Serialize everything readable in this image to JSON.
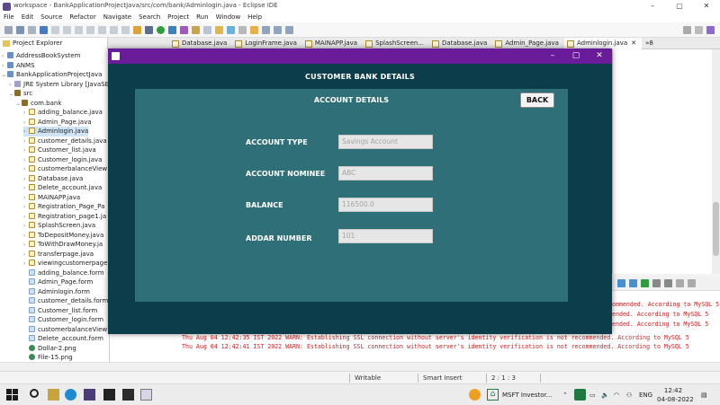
{
  "eclipse": {
    "title": "workspace - BankApplicationProjectJava/src/com/bank/Adminlogin.java - Eclipse IDE",
    "menu": [
      "File",
      "Edit",
      "Source",
      "Refactor",
      "Navigate",
      "Search",
      "Project",
      "Run",
      "Window",
      "Help"
    ],
    "explorer_tab": "Project Explorer",
    "editor_tabs": [
      "Database.java",
      "LoginFrame.java",
      "MAINAPP.java",
      "SplashScreen...",
      "Database.java",
      "Admin_Page.java",
      "Adminlogin.java"
    ],
    "overflow_count": "8",
    "tree": [
      {
        "label": "AddressBookSystem",
        "type": "proj",
        "indent": 0,
        "arrow": ">"
      },
      {
        "label": "ANMS",
        "type": "proj",
        "indent": 0,
        "arrow": ">"
      },
      {
        "label": "BankApplicationProjectJava",
        "type": "proj",
        "indent": 0,
        "arrow": "v"
      },
      {
        "label": "JRE System Library [JavaSE-",
        "type": "lib",
        "indent": 1,
        "arrow": ">"
      },
      {
        "label": "src",
        "type": "pkg",
        "indent": 1,
        "arrow": "v"
      },
      {
        "label": "com.bank",
        "type": "pkg",
        "indent": 2,
        "arrow": "v"
      },
      {
        "label": "adding_balance.java",
        "type": "java",
        "indent": 3,
        "arrow": ">"
      },
      {
        "label": "Admin_Page.java",
        "type": "java",
        "indent": 3,
        "arrow": ">"
      },
      {
        "label": "Adminlogin.java",
        "type": "java",
        "indent": 3,
        "arrow": ">",
        "selected": true
      },
      {
        "label": "customer_details.java",
        "type": "java",
        "indent": 3,
        "arrow": ">"
      },
      {
        "label": "Customer_list.java",
        "type": "java",
        "indent": 3,
        "arrow": ">"
      },
      {
        "label": "Customer_login.java",
        "type": "java",
        "indent": 3,
        "arrow": ">"
      },
      {
        "label": "customerbalanceView",
        "type": "java",
        "indent": 3,
        "arrow": ">"
      },
      {
        "label": "Database.java",
        "type": "java",
        "indent": 3,
        "arrow": ">"
      },
      {
        "label": "Delete_account.java",
        "type": "java",
        "indent": 3,
        "arrow": ">"
      },
      {
        "label": "MAINAPP.java",
        "type": "java",
        "indent": 3,
        "arrow": ">"
      },
      {
        "label": "Registration_Page_Pa",
        "type": "java",
        "indent": 3,
        "arrow": ">"
      },
      {
        "label": "Registration_page1.ja",
        "type": "java",
        "indent": 3,
        "arrow": ">"
      },
      {
        "label": "SplashScreen.java",
        "type": "java",
        "indent": 3,
        "arrow": ">"
      },
      {
        "label": "ToDepositMoney.java",
        "type": "java",
        "indent": 3,
        "arrow": ">"
      },
      {
        "label": "ToWithDrawMoney.ja",
        "type": "java",
        "indent": 3,
        "arrow": ">"
      },
      {
        "label": "transferpage.java",
        "type": "java",
        "indent": 3,
        "arrow": ">"
      },
      {
        "label": "viewingcustomerpage",
        "type": "java",
        "indent": 3,
        "arrow": ">"
      },
      {
        "label": "adding_balance.form",
        "type": "form",
        "indent": 3,
        "arrow": ""
      },
      {
        "label": "Admin_Page.form",
        "type": "form",
        "indent": 3,
        "arrow": ""
      },
      {
        "label": "Adminlogin.form",
        "type": "form",
        "indent": 3,
        "arrow": ""
      },
      {
        "label": "customer_details.form",
        "type": "form",
        "indent": 3,
        "arrow": ""
      },
      {
        "label": "Customer_list.form",
        "type": "form",
        "indent": 3,
        "arrow": ""
      },
      {
        "label": "Customer_login.form",
        "type": "form",
        "indent": 3,
        "arrow": ""
      },
      {
        "label": "customerbalanceView",
        "type": "form",
        "indent": 3,
        "arrow": ""
      },
      {
        "label": "Delete_account.form",
        "type": "form",
        "indent": 3,
        "arrow": ""
      },
      {
        "label": "Dollar-2.png",
        "type": "png",
        "indent": 3,
        "arrow": ""
      },
      {
        "label": "File-15.png",
        "type": "png",
        "indent": 3,
        "arrow": ""
      }
    ],
    "console_right": [
      "ommended. According to MySQL 5",
      "ended. According to MySQL 5",
      "ended. According to MySQL 5"
    ],
    "console_lines": [
      "Thu Aug 04 12:42:35 IST 2022 WARN: Establishing SSL connection without server's identity verification is not recommended. According to MySQL 5",
      "Thu Aug 04 12:42:41 IST 2022 WARN: Establishing SSL connection without server's identity verification is not recommended. According to MySQL 5"
    ],
    "status": {
      "writable": "Writable",
      "insert": "Smart Insert",
      "position": "2 : 1 : 3"
    }
  },
  "taskbar": {
    "stock": "MSFT Investor...",
    "lang": "ENG",
    "time": "12:42",
    "date": "04-08-2022"
  },
  "swing": {
    "heading": "CUSTOMER BANK DETAILS",
    "subheading": "ACCOUNT DETAILS",
    "back_label": "BACK",
    "fields": [
      {
        "label": "ACCOUNT TYPE",
        "value": "Savings Account"
      },
      {
        "label": "ACCOUNT NOMINEE",
        "value": "ABC"
      },
      {
        "label": "BALANCE",
        "value": "116500.0"
      },
      {
        "label": "ADDAR NUMBER",
        "value": "101"
      }
    ]
  },
  "colors": {
    "swing_titlebar": "#6a1b9a",
    "swing_bg": "#0b3d4a",
    "panel_bg": "#2f6f78",
    "console_warn": "#d21f1f"
  }
}
